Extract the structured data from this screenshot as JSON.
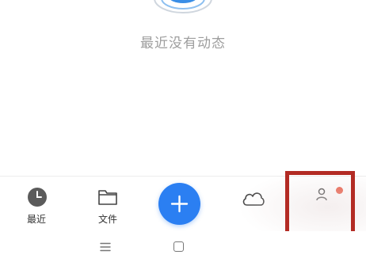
{
  "empty_state": {
    "message": "最近没有动态",
    "illustration_icon": "empty-activity-illustration"
  },
  "bottom_nav": {
    "items": [
      {
        "label": "最近",
        "icon": "clock-icon"
      },
      {
        "label": "文件",
        "icon": "folder-icon"
      },
      {
        "label": "",
        "icon": "plus-icon"
      },
      {
        "label": "",
        "icon": "cloud-icon"
      },
      {
        "label": "",
        "icon": "person-icon",
        "has_notification": true
      }
    ]
  },
  "system_nav": {
    "buttons": [
      "menu-icon",
      "home-icon"
    ]
  },
  "colors": {
    "accent": "#2b7ff2",
    "highlight": "#b32b24",
    "notification": "#e8553f",
    "muted_text": "#9e9e9e"
  }
}
